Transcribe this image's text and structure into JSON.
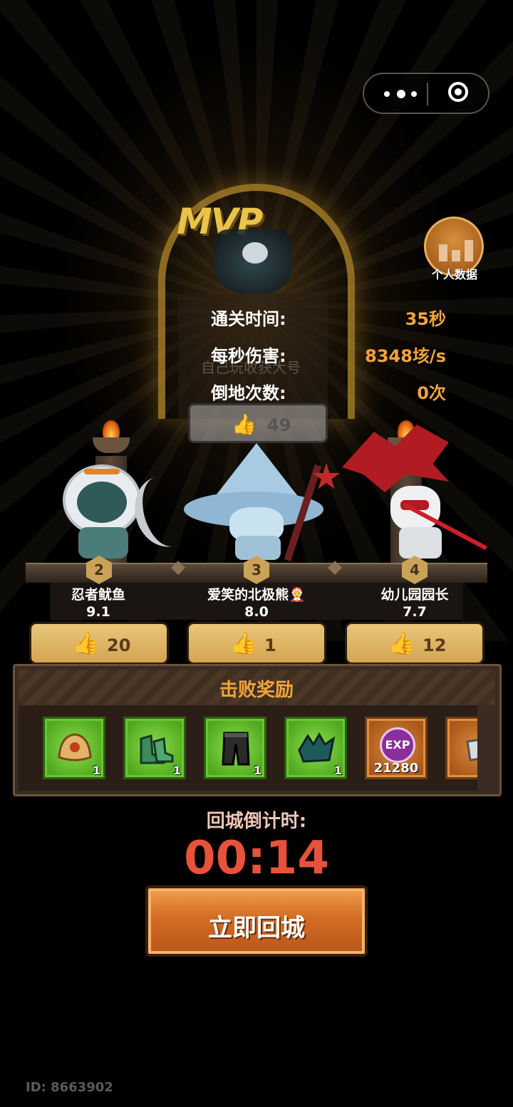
{
  "capsule": {
    "more_icon": "ellipsis-icon",
    "close_icon": "target-circle-icon"
  },
  "mvp": {
    "badge_text": "MVP",
    "stats": [
      {
        "label": "通关时间:",
        "value": "35秒"
      },
      {
        "label": "每秒伤害:",
        "value": "8348垓/s"
      },
      {
        "label": "倒地次数:",
        "value": "0次"
      }
    ],
    "faded_label": "自己玩收获大号",
    "likes": "49"
  },
  "personal_data": {
    "label": "个人数据",
    "icon": "bar-chart-icon"
  },
  "players": [
    {
      "rank": "2",
      "name": "忍者鱿鱼",
      "score": "9.1",
      "likes": "20"
    },
    {
      "rank": "3",
      "name": "爱笑的北极熊🤶",
      "score": "8.0",
      "likes": "1"
    },
    {
      "rank": "4",
      "name": "幼儿园园长",
      "score": "7.7",
      "likes": "12"
    }
  ],
  "rewards": {
    "title": "击败奖励",
    "items": [
      {
        "icon": "helmet-icon",
        "count": "1"
      },
      {
        "icon": "boots-icon",
        "count": "1"
      },
      {
        "icon": "pants-icon",
        "count": "1"
      },
      {
        "icon": "armor-icon",
        "count": "1"
      },
      {
        "icon": "exp-icon",
        "label": "EXP",
        "count": "21280"
      },
      {
        "icon": "gauntlet-icon",
        "count": ""
      }
    ]
  },
  "countdown": {
    "label": "回城倒计时:",
    "time": "00:14"
  },
  "return_button": {
    "label": "立即回城"
  },
  "footer": {
    "id_text": "ID: 8663902"
  },
  "colors": {
    "accent_orange": "#f2a43a",
    "timer_red": "#e8523a",
    "item_green": "#4fa81f"
  }
}
